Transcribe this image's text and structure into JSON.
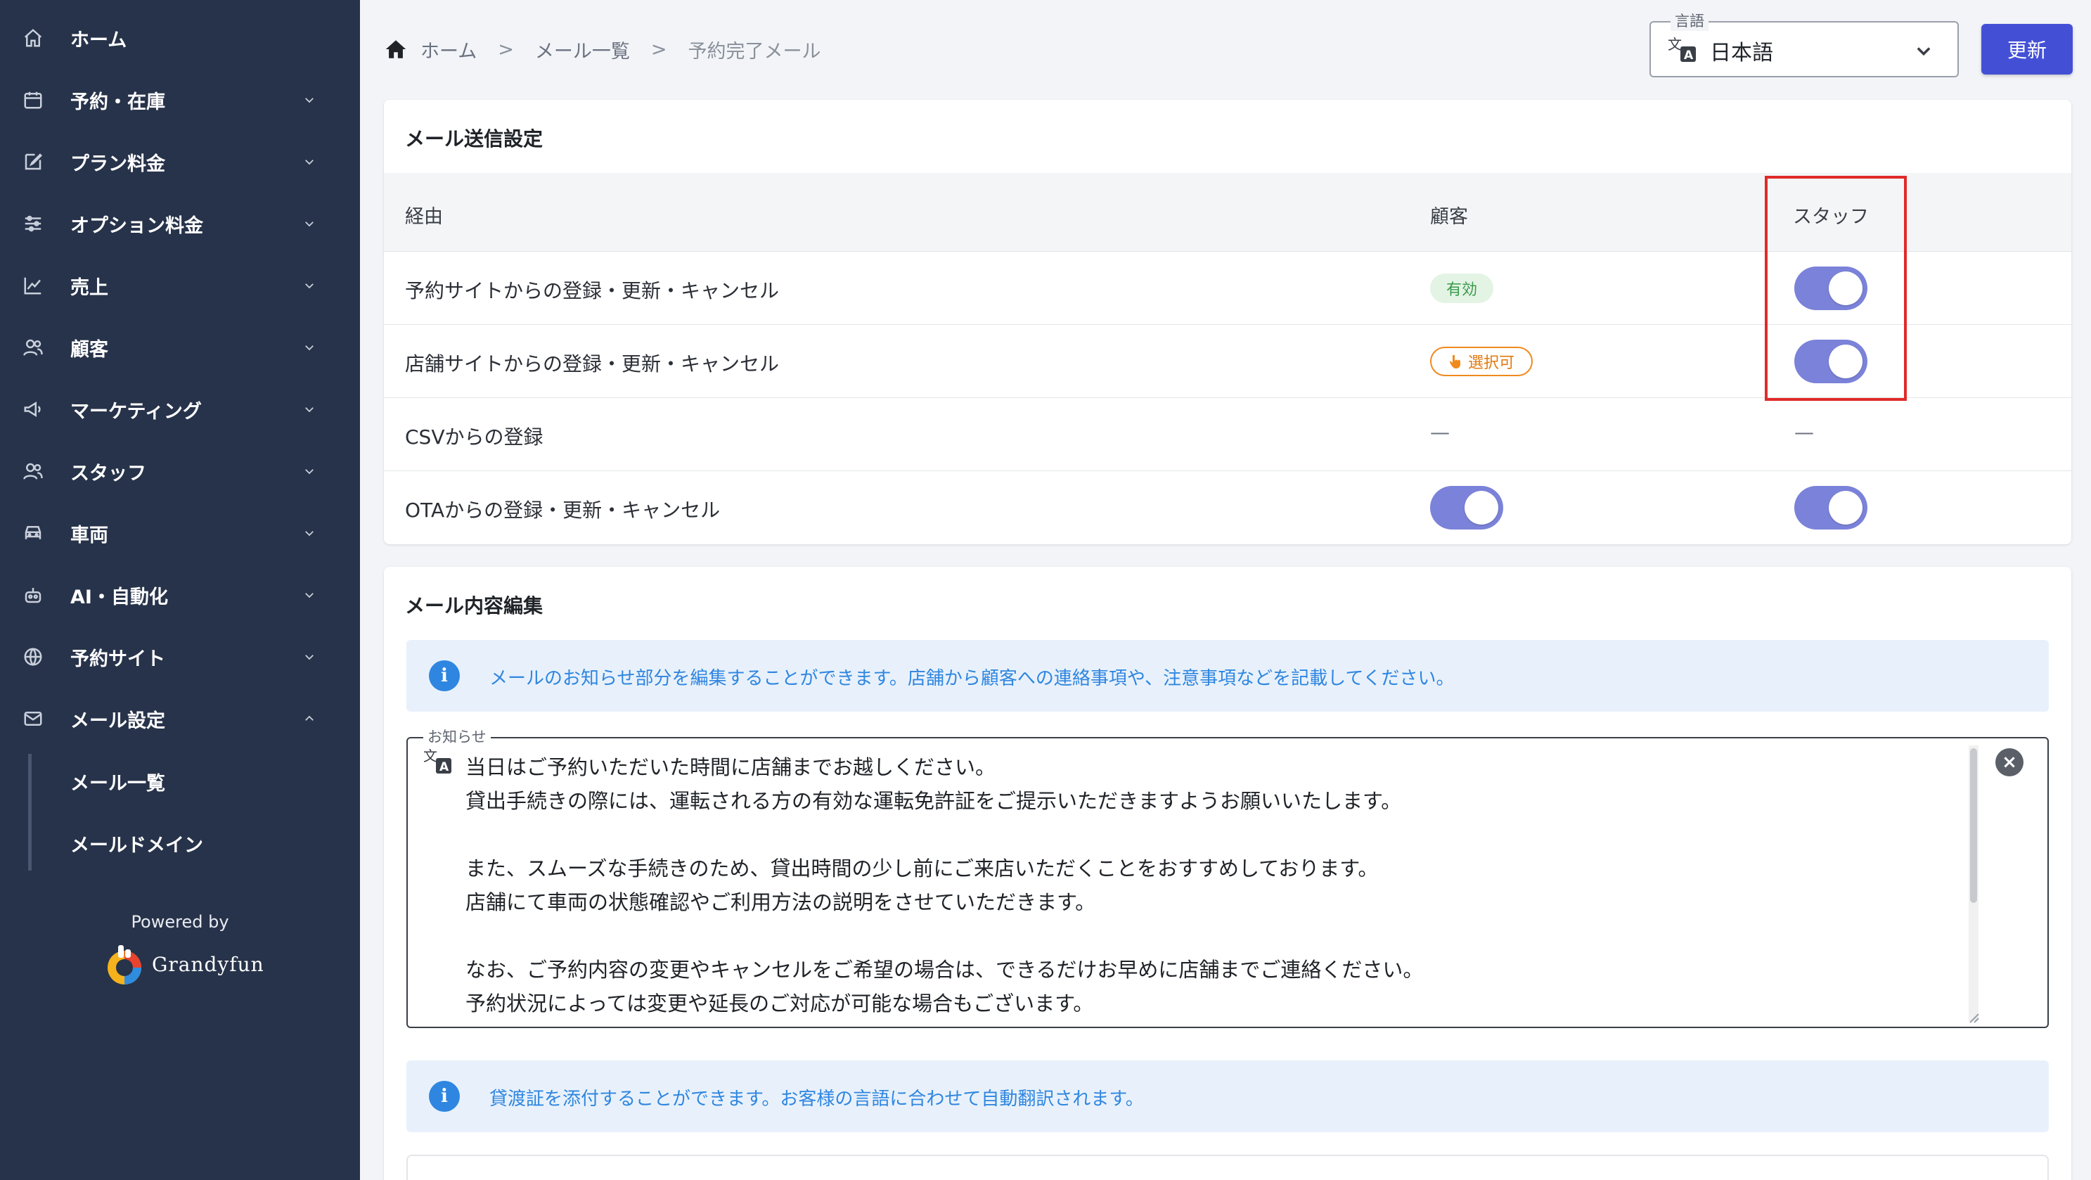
{
  "sidebar": {
    "items": [
      {
        "label": "ホーム",
        "icon": "home-icon"
      },
      {
        "label": "予約・在庫",
        "icon": "calendar-icon"
      },
      {
        "label": "プラン料金",
        "icon": "edit-icon"
      },
      {
        "label": "オプション料金",
        "icon": "sliders-icon"
      },
      {
        "label": "売上",
        "icon": "chart-icon"
      },
      {
        "label": "顧客",
        "icon": "users-icon"
      },
      {
        "label": "マーケティング",
        "icon": "megaphone-icon"
      },
      {
        "label": "スタッフ",
        "icon": "staff-icon"
      },
      {
        "label": "車両",
        "icon": "car-icon"
      },
      {
        "label": "AI・自動化",
        "icon": "robot-icon"
      },
      {
        "label": "予約サイト",
        "icon": "globe-icon"
      },
      {
        "label": "メール設定",
        "icon": "mail-icon"
      }
    ],
    "sub_items": [
      {
        "label": "メール一覧"
      },
      {
        "label": "メールドメイン"
      }
    ],
    "powered_by": "Powered by",
    "brand_name": "Grandyfun"
  },
  "breadcrumb": {
    "items": [
      "ホーム",
      "メール一覧",
      "予約完了メール"
    ],
    "separator": ">"
  },
  "language_select": {
    "legend": "言語",
    "value": "日本語"
  },
  "update_button": "更新",
  "send_settings": {
    "title": "メール送信設定",
    "headers": {
      "route": "経由",
      "customer": "顧客",
      "staff": "スタッフ"
    },
    "rows": [
      {
        "label": "予約サイトからの登録・更新・キャンセル",
        "customer": "有効",
        "customer_type": "badge-enabled",
        "staff": "on"
      },
      {
        "label": "店舗サイトからの登録・更新・キャンセル",
        "customer": "選択可",
        "customer_type": "badge-selectable",
        "staff": "on"
      },
      {
        "label": "CSVからの登録",
        "customer": "—",
        "customer_type": "dash",
        "staff": "—"
      },
      {
        "label": "OTAからの登録・更新・キャンセル",
        "customer": "on",
        "customer_type": "toggle",
        "staff": "on"
      }
    ]
  },
  "content_edit": {
    "title": "メール内容編集",
    "info": "メールのお知らせ部分を編集することができます。店舗から顧客への連絡事項や、注意事項などを記載してください。",
    "notice_legend": "お知らせ",
    "notice_lines": [
      "当日はご予約いただいた時間に店舗までお越しください。",
      "貸出手続きの際には、運転される方の有効な運転免許証をご提示いただきますようお願いいたします。",
      "",
      "また、スムーズな手続きのため、貸出時間の少し前にご来店いただくことをおすすめしております。",
      "店舗にて車両の状態確認やご利用方法の説明をさせていただきます。",
      "",
      "なお、ご予約内容の変更やキャンセルをご希望の場合は、できるだけお早めに店舗までご連絡ください。",
      "予約状況によっては変更や延長のご対応が可能な場合もございます。"
    ],
    "info2": "貸渡証を添付することができます。お客様の言語に合わせて自動翻訳されます。"
  },
  "colors": {
    "sidebar_bg": "#27334a",
    "accent": "#4350d6",
    "toggle_on": "#7b82d9",
    "info_text": "#2f86e0",
    "highlight": "#e02a2a"
  }
}
